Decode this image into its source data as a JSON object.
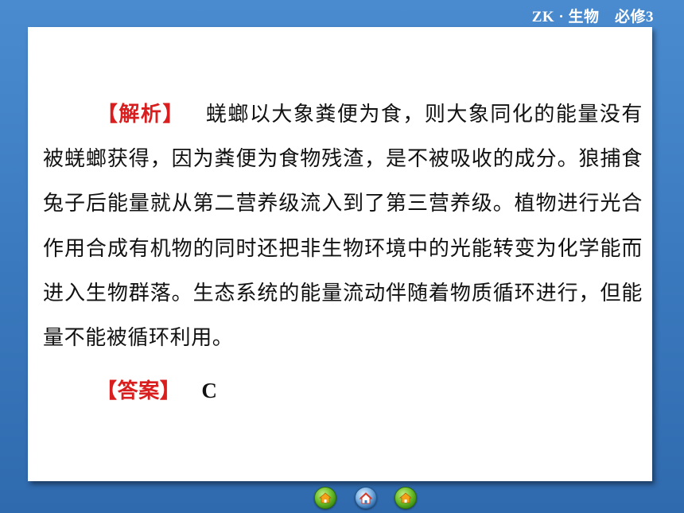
{
  "header": {
    "course_label": "ZK · 生物　必修3"
  },
  "content": {
    "analysis_tag": "【解析】",
    "analysis_text": "蜣螂以大象粪便为食，则大象同化的能量没有被蜣螂获得，因为粪便为食物残渣，是不被吸收的成分。狼捕食兔子后能量就从第二营养级流入到了第三营养级。植物进行光合作用合成有机物的同时还把非生物环境中的光能转变为化学能而进入生物群落。生态系统的能量流动伴随着物质循环进行，但能量不能被循环利用。",
    "answer_tag": "【答案】",
    "answer_value": "C"
  },
  "nav": {
    "prev_icon": "house-back-icon",
    "home_icon": "globe-home-icon",
    "next_icon": "house-forward-icon"
  },
  "colors": {
    "background": "#3f7ec2",
    "panel": "#ffffff",
    "tag": "#d81e1e",
    "text": "#111111"
  }
}
